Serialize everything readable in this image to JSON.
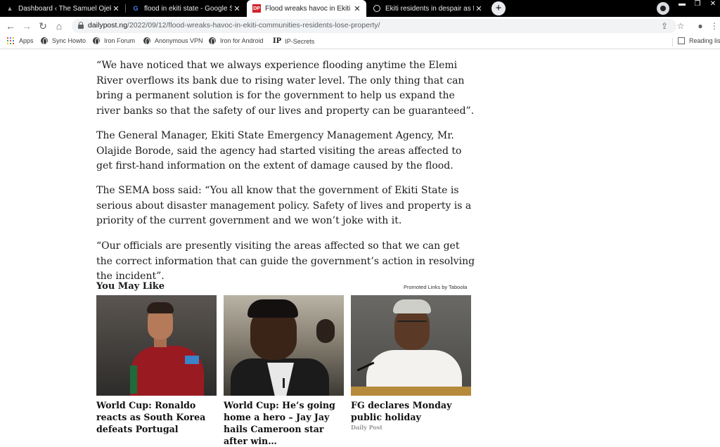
{
  "browser": {
    "tabs": [
      {
        "title": "Dashboard ‹ The Samuel Ojekwe",
        "favicon": "wordpress-icon",
        "active": false
      },
      {
        "title": "flood in ekiti state - Google Sear",
        "favicon": "google-icon",
        "active": false
      },
      {
        "title": "Flood wreaks havoc in Ekiti comm",
        "favicon": "dailypost-icon",
        "active": true
      },
      {
        "title": "Ekiti residents in despair as flood",
        "favicon": "globe-icon",
        "active": false
      }
    ],
    "favicon_text": {
      "dailypost": "DP",
      "google": "G"
    },
    "url_host": "dailypost.ng",
    "url_path": "/2022/09/12/flood-wreaks-havoc-in-ekiti-communities-residents-lose-property/",
    "bookmarks": [
      "Apps",
      "Sync Howto",
      "Iron Forum",
      "Anonymous VPN",
      "Iron for Android",
      "IP-Secrets"
    ],
    "ip_icon_text": "IP",
    "reading_list": "Reading list",
    "colors": {
      "tabstrip": "#000000",
      "google_red": "#ea4335",
      "dailypost_red": "#d2232a"
    }
  },
  "article": {
    "paragraphs": [
      "“We have noticed that we always experience flooding anytime the Elemi River overflows its bank due to rising water level. The only thing that can bring a permanent solution is for the government to help us expand the river banks so that the safety of our lives and property can be guaranteed”.",
      "The General Manager, Ekiti State Emergency Management Agency, Mr. Olajide Borode, said the agency had started visiting the areas affected to get first-hand information on the extent of damage caused by the flood.",
      "The SEMA boss said: “You all know that the government of Ekiti State is serious about disaster management policy. Safety of lives and property is a priority of the current government and we won’t joke with it.",
      "“Our officials are presently visiting the areas affected so that we can get the correct information that can guide the government’s action in resolving the incident”."
    ]
  },
  "you_may_like": {
    "title": "You May Like",
    "promoted": "Promoted Links by Taboola",
    "cards": [
      {
        "headline": "World Cup: Ronaldo reacts as South Korea defeats Portugal",
        "source": ""
      },
      {
        "headline": "World Cup: He’s going home a hero – Jay Jay hails Cameroon star after win…",
        "source": ""
      },
      {
        "headline": "FG declares Monday public holiday",
        "source": "Daily Post"
      }
    ]
  }
}
